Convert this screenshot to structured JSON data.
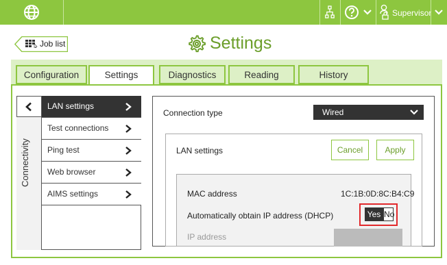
{
  "topbar": {
    "user_label": "Supervisor",
    "color": "#8dc63f"
  },
  "header": {
    "back_label": "Job list",
    "title": "Settings"
  },
  "tabs": [
    {
      "label": "Configuration",
      "active": false
    },
    {
      "label": "Settings",
      "active": true
    },
    {
      "label": "Diagnostics",
      "active": false
    },
    {
      "label": "Reading",
      "active": false
    },
    {
      "label": "History",
      "active": false
    }
  ],
  "sidebar": {
    "section_label": "Connectivity",
    "items": [
      {
        "label": "LAN settings",
        "active": true
      },
      {
        "label": "Test connections",
        "active": false
      },
      {
        "label": "Ping test",
        "active": false
      },
      {
        "label": "Web browser",
        "active": false
      },
      {
        "label": "AIMS settings",
        "active": false
      }
    ]
  },
  "main": {
    "connection_type_label": "Connection type",
    "connection_type_value": "Wired",
    "lan_title": "LAN settings",
    "cancel_label": "Cancel",
    "apply_label": "Apply",
    "mac_label": "MAC address",
    "mac_value": "1C:1B:0D:8C:B4:C9",
    "dhcp_label": "Automatically obtain IP address (DHCP)",
    "dhcp_yes": "Yes",
    "dhcp_no": "No",
    "ip_label": "IP address"
  }
}
